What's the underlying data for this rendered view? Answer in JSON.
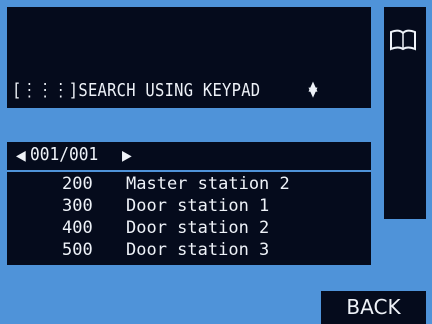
{
  "header": {
    "search_label": "[⋮⋮⋮]SEARCH USING KEYPAD",
    "scroll_icon": "up-down-arrows-icon",
    "book_icon": "book-icon"
  },
  "nav": {
    "prev_glyph": "◀",
    "page": "001/001",
    "next_glyph": "▶"
  },
  "list": {
    "rows": [
      {
        "number": "200",
        "name": "Master station 2"
      },
      {
        "number": "300",
        "name": "Door station 1"
      },
      {
        "number": "400",
        "name": "Door station 2"
      },
      {
        "number": "500",
        "name": "Door station 3"
      }
    ]
  },
  "footer": {
    "back_label": "BACK"
  },
  "colors": {
    "background": "#4f93d9",
    "panel": "#050b1c",
    "text": "#eef2f8"
  }
}
